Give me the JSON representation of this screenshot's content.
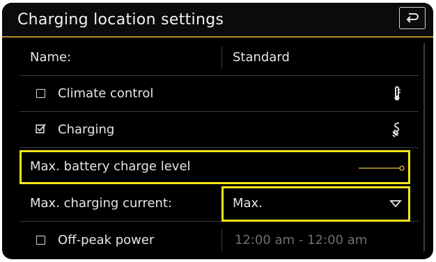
{
  "header": {
    "title": "Charging location settings",
    "back_icon": "back-arrow-icon"
  },
  "rows": {
    "name": {
      "label": "Name:",
      "value": "Standard"
    },
    "climate": {
      "label": "Climate control",
      "checked": false,
      "icon": "thermometer-icon"
    },
    "charging": {
      "label": "Charging",
      "checked": true,
      "icon": "charging-plug-icon"
    },
    "battery": {
      "label": "Max. battery charge level",
      "slider_level": 1.0,
      "icon": "slider-icon"
    },
    "current": {
      "label": "Max. charging current:",
      "value": "Max.",
      "icon": "dropdown-triangle-icon"
    },
    "offpeak": {
      "label": "Off-peak power",
      "checked": false,
      "value": "12:00 am - 12:00 am"
    }
  },
  "colors": {
    "accent_line": "#b4902a",
    "highlight": "#f6e51b",
    "slider": "#c9a237",
    "text": "#e6e6e6",
    "dim_text": "#6f6f6f"
  }
}
